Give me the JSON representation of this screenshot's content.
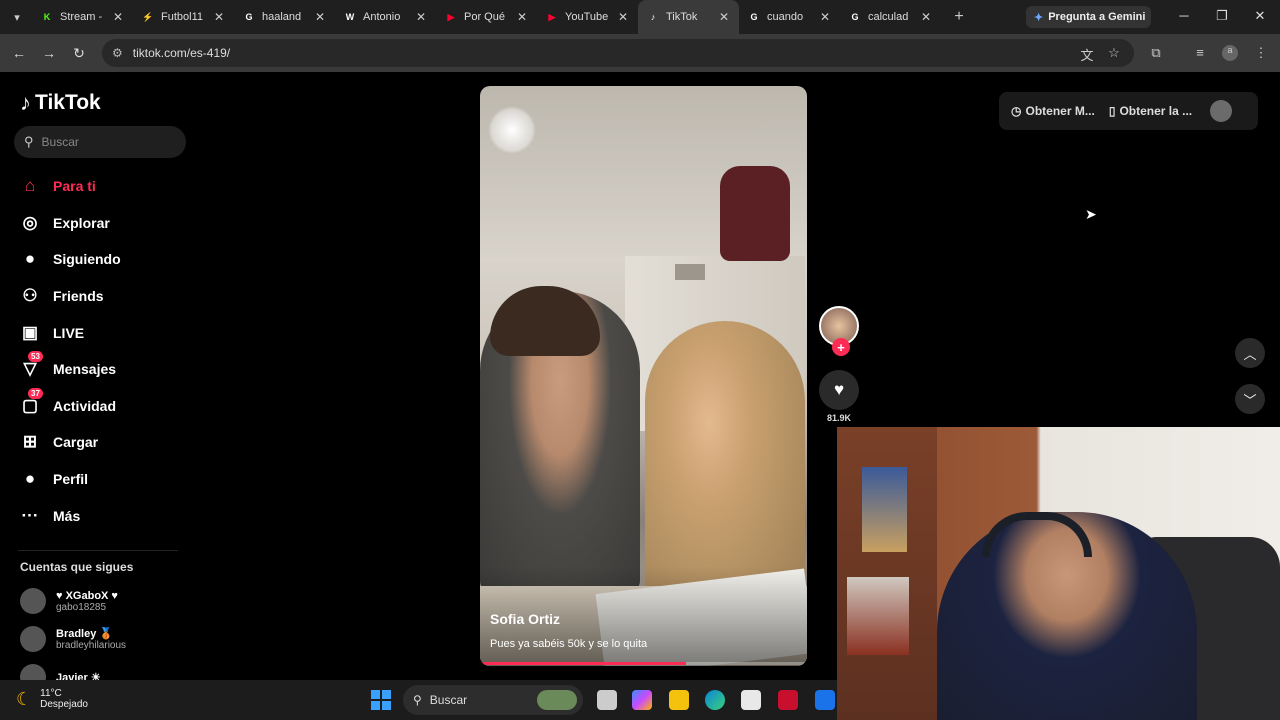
{
  "browser": {
    "tabs": [
      {
        "label": "Stream -",
        "fav": "K",
        "fav_color": "#53fc18"
      },
      {
        "label": "Futbol11",
        "fav": "⚡",
        "fav_color": "#3b6dff"
      },
      {
        "label": "haaland",
        "fav": "G",
        "fav_color": "#ffffff"
      },
      {
        "label": "Antonio",
        "fav": "W",
        "fav_color": "#ffffff"
      },
      {
        "label": "Por Qué",
        "fav": "▶",
        "fav_color": "#ff0033"
      },
      {
        "label": "YouTube",
        "fav": "▶",
        "fav_color": "#ff0033"
      },
      {
        "label": "TikTok",
        "fav": "♪",
        "fav_color": "#ffffff"
      },
      {
        "label": "cuando",
        "fav": "G",
        "fav_color": "#ffffff"
      },
      {
        "label": "calculad",
        "fav": "G",
        "fav_color": "#ffffff"
      }
    ],
    "gemini_label": "Pregunta a Gemini",
    "url": "tiktok.com/es-419/"
  },
  "tiktok": {
    "logo_text": "TikTok",
    "search_placeholder": "Buscar",
    "nav": [
      {
        "label": "Para ti",
        "icon": "home-icon",
        "glyph": "⌂"
      },
      {
        "label": "Explorar",
        "icon": "compass-icon",
        "glyph": "◎"
      },
      {
        "label": "Siguiendo",
        "icon": "avatar-icon",
        "glyph": "●"
      },
      {
        "label": "Friends",
        "icon": "friends-icon",
        "glyph": "⚇"
      },
      {
        "label": "LIVE",
        "icon": "live-icon",
        "glyph": "▣"
      },
      {
        "label": "Mensajes",
        "icon": "messages-icon",
        "glyph": "▽",
        "badge": "53"
      },
      {
        "label": "Actividad",
        "icon": "activity-icon",
        "glyph": "▢",
        "badge": "37"
      },
      {
        "label": "Cargar",
        "icon": "upload-icon",
        "glyph": "⊞"
      },
      {
        "label": "Perfil",
        "icon": "profile-icon",
        "glyph": "●"
      },
      {
        "label": "Más",
        "icon": "more-icon",
        "glyph": "···"
      }
    ],
    "following_title": "Cuentas que sigues",
    "accounts": [
      {
        "name": "♥ XGaboX ♥",
        "username": "gabo18285"
      },
      {
        "name": "Bradley 🥉",
        "username": "bradleyhilarious"
      },
      {
        "name": "Javier ☀",
        "username": ""
      }
    ],
    "video": {
      "author": "Sofia Ortiz",
      "caption": "Pues ya sabéis 50k y se lo quita",
      "progress_fraction": 0.63
    },
    "actions": {
      "likes": "81.9K"
    },
    "top_right": {
      "item1": "Obtener M...",
      "item2": "Obtener la ..."
    }
  },
  "taskbar": {
    "temp": "11°C",
    "weather": "Despejado",
    "search_label": "Buscar"
  },
  "colors": {
    "accent": "#fe2c55"
  }
}
